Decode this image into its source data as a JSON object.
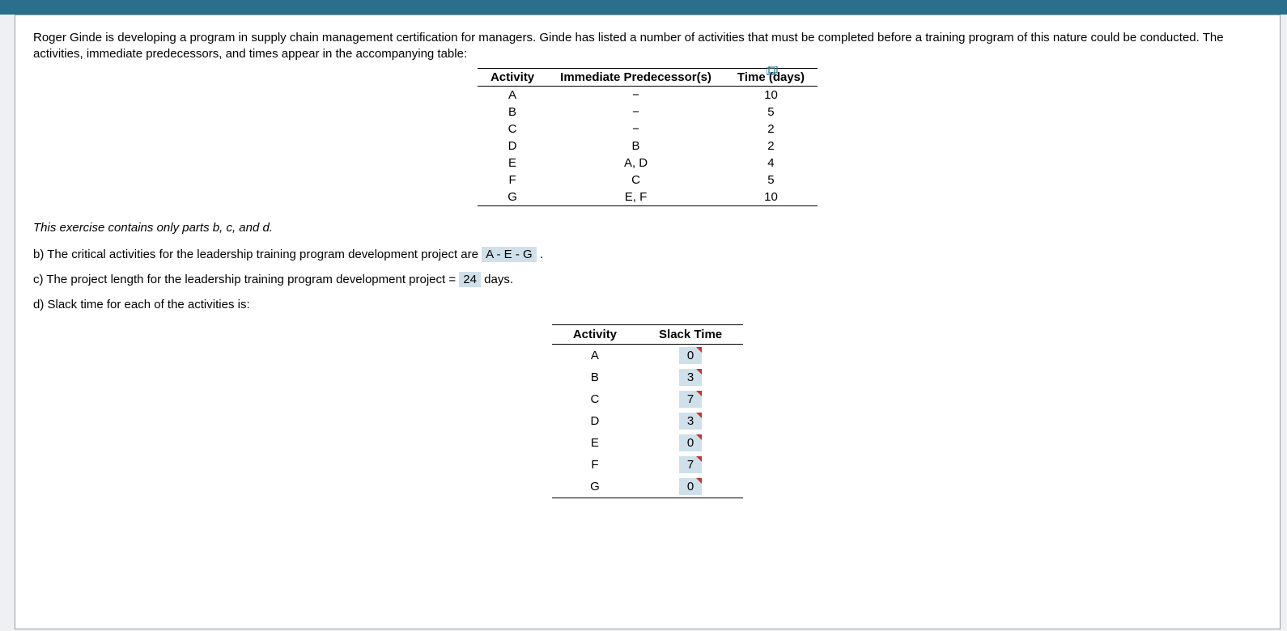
{
  "intro": "Roger Ginde is developing a program in supply chain management certification for managers. Ginde has listed a number of activities that must be completed before a training program of this nature could be conducted. The activities, immediate predecessors, and times appear in the accompanying table:",
  "activities_table": {
    "headers": {
      "c0": "Activity",
      "c1": "Immediate Predecessor(s)",
      "c2": "Time (days)"
    },
    "rows": [
      {
        "act": "A",
        "pred": "−",
        "time": "10"
      },
      {
        "act": "B",
        "pred": "−",
        "time": "5"
      },
      {
        "act": "C",
        "pred": "−",
        "time": "2"
      },
      {
        "act": "D",
        "pred": "B",
        "time": "2"
      },
      {
        "act": "E",
        "pred": "A, D",
        "time": "4"
      },
      {
        "act": "F",
        "pred": "C",
        "time": "5"
      },
      {
        "act": "G",
        "pred": "E, F",
        "time": "10"
      }
    ]
  },
  "note": "This exercise contains only parts b, c, and d.",
  "part_b": {
    "text_before": "b) The critical activities for the leadership training program development project are ",
    "answer": "A - E - G",
    "text_after": " ."
  },
  "part_c": {
    "text_before": "c) The project length for the leadership training program development project = ",
    "answer": "24",
    "text_after": " days."
  },
  "part_d": {
    "text": "d) Slack time for each of the activities is:"
  },
  "slack_table": {
    "headers": {
      "c0": "Activity",
      "c1": "Slack Time"
    },
    "rows": [
      {
        "act": "A",
        "slack": "0"
      },
      {
        "act": "B",
        "slack": "3"
      },
      {
        "act": "C",
        "slack": "7"
      },
      {
        "act": "D",
        "slack": "3"
      },
      {
        "act": "E",
        "slack": "0"
      },
      {
        "act": "F",
        "slack": "7"
      },
      {
        "act": "G",
        "slack": "0"
      }
    ]
  },
  "icons": {
    "popout": "popout-icon"
  }
}
